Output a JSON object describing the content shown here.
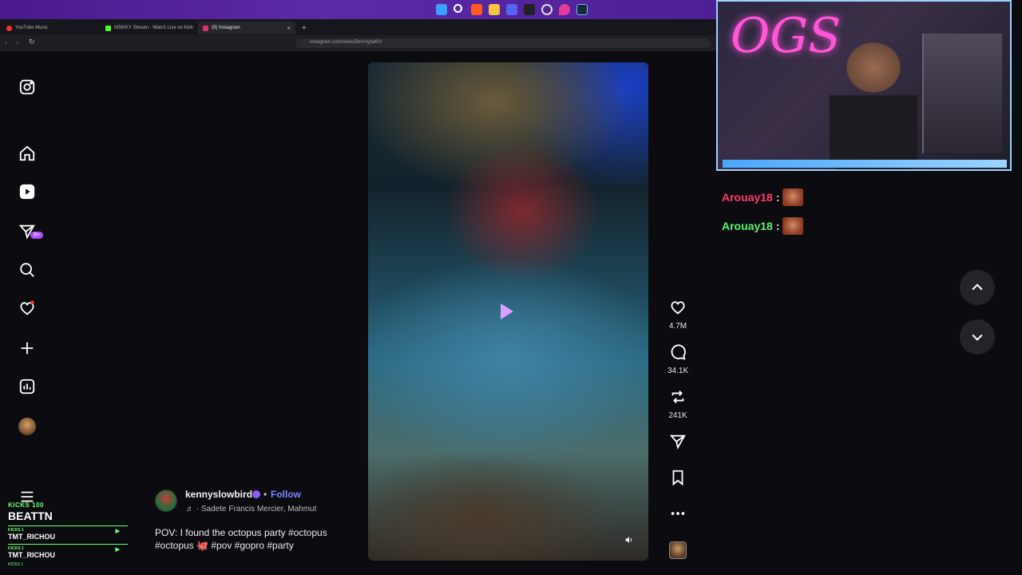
{
  "taskbar": {
    "icons": [
      "windows-icon",
      "search-icon",
      "brave-icon",
      "folder-icon",
      "discord-icon",
      "terminal-icon",
      "settings-icon",
      "location-icon",
      "steam-icon"
    ]
  },
  "browser": {
    "tabs": [
      {
        "label": "YouTube Music",
        "color": "#ff2d2d"
      },
      {
        "label": "M3IKKY Stream - Watch Live on Kick",
        "color": "#53fc18"
      },
      {
        "label": "(9) Instagram",
        "color": "#e1306c"
      }
    ],
    "url": "instagram.com/reels/DbIvVyjIaK0/"
  },
  "sidebar": {
    "badge": "9+"
  },
  "reel": {
    "likes": "4.7M",
    "comments": "34.1K",
    "reposts": "241K",
    "username": "kennyslowbird",
    "follow": "Follow",
    "dot": "•",
    "music": "· Sadete  Francis Mercier, Mahmut",
    "caption_text": "POV: I found the octopus party",
    "caption_tags": "#octopus #octopus 🐙 #pov #gopro #party"
  },
  "chat": [
    {
      "user": "Arouay18",
      "colon": ":",
      "color": "#ff3b6a"
    },
    {
      "user": "Arouay18",
      "colon": ":",
      "color": "#5bf06f"
    }
  ],
  "overlay": {
    "kicks_label": "KICKS 100",
    "top_name": "BEATTN",
    "rows": [
      {
        "small": "KICKS 1",
        "name": "TMT_RICHOU"
      },
      {
        "small": "KICKS 1",
        "name": "TMT_RICHOU"
      }
    ],
    "tail_small": "KICKS 1"
  },
  "webcam": {
    "logo": "OGS"
  }
}
